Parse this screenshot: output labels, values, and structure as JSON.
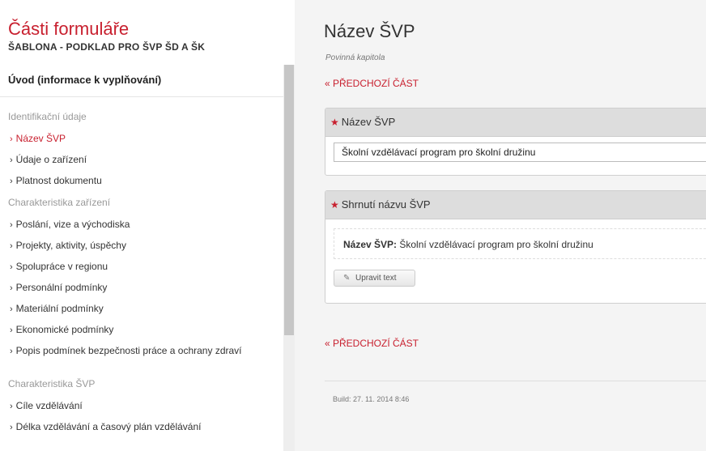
{
  "sidebar": {
    "title": "Části formuláře",
    "subtitle": "ŠABLONA - PODKLAD PRO ŠVP ŠD A ŠK",
    "intro": "Úvod (informace k vyplňování)",
    "nav": [
      {
        "type": "section",
        "label": "Identifikační údaje"
      },
      {
        "type": "item",
        "label": "Název ŠVP",
        "active": true
      },
      {
        "type": "item",
        "label": "Údaje o zařízení"
      },
      {
        "type": "item",
        "label": "Platnost dokumentu"
      },
      {
        "type": "section",
        "label": "Charakteristika zařízení"
      },
      {
        "type": "item",
        "label": "Poslání, vize a východiska"
      },
      {
        "type": "item",
        "label": "Projekty, aktivity, úspěchy"
      },
      {
        "type": "item",
        "label": "Spolupráce v regionu"
      },
      {
        "type": "item",
        "label": "Personální podmínky"
      },
      {
        "type": "item",
        "label": "Materiální podmínky"
      },
      {
        "type": "item",
        "label": "Ekonomické podmínky"
      },
      {
        "type": "item",
        "label": "Popis podmínek bezpečnosti práce a ochrany zdraví",
        "two": true
      },
      {
        "type": "section",
        "label": "Charakteristika ŠVP"
      },
      {
        "type": "item",
        "label": "Cíle vzdělávání"
      },
      {
        "type": "item",
        "label": "Délka vzdělávání a časový plán vzdělávání"
      }
    ],
    "chevron": "›"
  },
  "main": {
    "title": "Název ŠVP",
    "subtitle": "Povinná kapitola",
    "prev_link": "« PŘEDCHOZÍ ČÁST",
    "panel_name": {
      "label": "Název ŠVP",
      "value": "Školní vzdělávací program pro školní družinu"
    },
    "panel_summary": {
      "label": "Shrnutí názvu ŠVP",
      "key": "Název ŠVP:",
      "value": "Školní vzdělávací program pro školní družinu",
      "edit_label": "Upravit text"
    },
    "build": "Build: 27. 11. 2014 8:46"
  },
  "icons": {
    "required": "asterisk-icon",
    "edit": "pencil-icon"
  },
  "colors": {
    "accent": "#c8202f"
  }
}
